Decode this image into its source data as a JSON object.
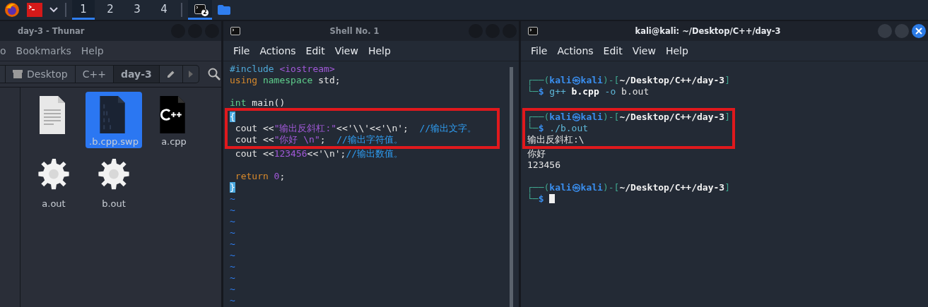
{
  "taskbar": {
    "workspaces": [
      {
        "label": "1",
        "selected": true
      },
      {
        "label": "2",
        "selected": false
      },
      {
        "label": "3",
        "selected": false
      },
      {
        "label": "4",
        "selected": false
      }
    ],
    "task_badge": "2"
  },
  "file_manager": {
    "title": "day-3 - Thunar",
    "menu": [
      "o",
      "Bookmarks",
      "Help"
    ],
    "path": [
      {
        "label": "Desktop",
        "kind": "drive",
        "selected": false
      },
      {
        "label": "C++",
        "kind": "folder",
        "selected": false
      },
      {
        "label": "day-3",
        "kind": "folder",
        "selected": true
      }
    ],
    "files": [
      {
        "kind": "text",
        "selected": false
      },
      {
        "name": ".b.cpp.swp",
        "kind": "binary",
        "selected": true
      },
      {
        "name": "a.cpp",
        "kind": "cpp",
        "selected": false
      },
      {
        "name": "a.out",
        "kind": "exec",
        "selected": false
      },
      {
        "name": "b.out",
        "kind": "exec",
        "selected": false
      }
    ]
  },
  "editor": {
    "title": "Shell No. 1",
    "menu": [
      "File",
      "Actions",
      "Edit",
      "View",
      "Help"
    ],
    "lines": [
      {
        "kind": "code",
        "tokens": [
          {
            "kind": "preproc",
            "text": "#include"
          },
          {
            "kind": "string",
            "text": " <iostream>"
          }
        ]
      },
      {
        "kind": "code",
        "tokens": [
          {
            "kind": "keyword",
            "text": "using"
          },
          {
            "kind": "type",
            "text": " namespace"
          },
          {
            "kind": "plain",
            "text": " std;"
          }
        ]
      },
      {
        "kind": "blank"
      },
      {
        "kind": "code",
        "tokens": [
          {
            "kind": "type",
            "text": "int"
          },
          {
            "kind": "plain",
            "text": " main()"
          }
        ]
      },
      {
        "kind": "code",
        "boxed": true,
        "tokens": [
          {
            "kind": "match",
            "text": "{"
          }
        ]
      },
      {
        "kind": "code",
        "boxed": true,
        "tokens": [
          {
            "kind": "plain",
            "text": " cout <<"
          },
          {
            "kind": "string",
            "text": "\"输出反斜杠:\""
          },
          {
            "kind": "plain",
            "text": "<<'\\\\'<<'\\n';"
          },
          {
            "kind": "comment",
            "text": "  //输出文字。"
          }
        ]
      },
      {
        "kind": "code",
        "boxed": true,
        "tokens": [
          {
            "kind": "plain",
            "text": " cout <<"
          },
          {
            "kind": "string",
            "text": "\"你好 \\n\""
          },
          {
            "kind": "plain",
            "text": ";"
          },
          {
            "kind": "comment",
            "text": "  //输出字符值。"
          }
        ]
      },
      {
        "kind": "code",
        "tokens": [
          {
            "kind": "plain",
            "text": " cout <<"
          },
          {
            "kind": "number",
            "text": "123456"
          },
          {
            "kind": "plain",
            "text": "<<'\\n';"
          },
          {
            "kind": "comment",
            "text": "//输出数值。"
          }
        ]
      },
      {
        "kind": "blank"
      },
      {
        "kind": "code",
        "tokens": [
          {
            "kind": "keyword",
            "text": " return"
          },
          {
            "kind": "number",
            "text": " 0"
          },
          {
            "kind": "plain",
            "text": ";"
          }
        ]
      },
      {
        "kind": "code",
        "tokens": [
          {
            "kind": "cursor",
            "text": "}"
          }
        ]
      }
    ],
    "empty_lines": [
      "~",
      "~",
      "~",
      "~",
      "~",
      "~",
      "~",
      "~",
      "~",
      "~"
    ]
  },
  "terminal": {
    "title": "kali@kali: ~/Desktop/C++/day-3",
    "menu": [
      "File",
      "Actions",
      "Edit",
      "View",
      "Help"
    ],
    "lines": [
      {
        "kind": "blank"
      },
      {
        "kind": "code",
        "tokens": [
          {
            "kind": "frame",
            "text": "┌──("
          },
          {
            "kind": "user",
            "text": "kali㉿kali"
          },
          {
            "kind": "frame",
            "text": ")-["
          },
          {
            "kind": "path",
            "text": "~/Desktop/C++/day-3"
          },
          {
            "kind": "frame",
            "text": "]"
          }
        ]
      },
      {
        "kind": "code",
        "tokens": [
          {
            "kind": "frame",
            "text": "└─"
          },
          {
            "kind": "user",
            "text": "$"
          },
          {
            "kind": "cmd",
            "text": " g++"
          },
          {
            "kind": "bold",
            "text": " b.cpp"
          },
          {
            "kind": "cmd",
            "text": " -o"
          },
          {
            "kind": "plain",
            "text": " b.out"
          }
        ]
      },
      {
        "kind": "blank"
      },
      {
        "kind": "code",
        "boxed": true,
        "tokens": [
          {
            "kind": "frame",
            "text": "┌──("
          },
          {
            "kind": "user",
            "text": "kali㉿kali"
          },
          {
            "kind": "frame",
            "text": ")-["
          },
          {
            "kind": "path",
            "text": "~/Desktop/C++/day-3"
          },
          {
            "kind": "frame",
            "text": "]"
          }
        ]
      },
      {
        "kind": "code",
        "boxed": true,
        "tokens": [
          {
            "kind": "frame",
            "text": "└─"
          },
          {
            "kind": "user",
            "text": "$"
          },
          {
            "kind": "cmd",
            "text": " ./b.out"
          }
        ]
      },
      {
        "kind": "code",
        "boxed": true,
        "tokens": [
          {
            "kind": "plain",
            "text": "输出反斜杠:\\"
          }
        ]
      },
      {
        "kind": "code",
        "tokens": [
          {
            "kind": "plain",
            "text": "你好"
          }
        ]
      },
      {
        "kind": "code",
        "tokens": [
          {
            "kind": "plain",
            "text": "123456"
          }
        ]
      },
      {
        "kind": "blank"
      },
      {
        "kind": "code",
        "tokens": [
          {
            "kind": "frame",
            "text": "┌──("
          },
          {
            "kind": "user",
            "text": "kali㉿kali"
          },
          {
            "kind": "frame",
            "text": ")-["
          },
          {
            "kind": "path",
            "text": "~/Desktop/C++/day-3"
          },
          {
            "kind": "frame",
            "text": "]"
          }
        ]
      },
      {
        "kind": "code",
        "cursor": true,
        "tokens": [
          {
            "kind": "frame",
            "text": "└─"
          },
          {
            "kind": "user",
            "text": "$"
          }
        ]
      }
    ]
  }
}
